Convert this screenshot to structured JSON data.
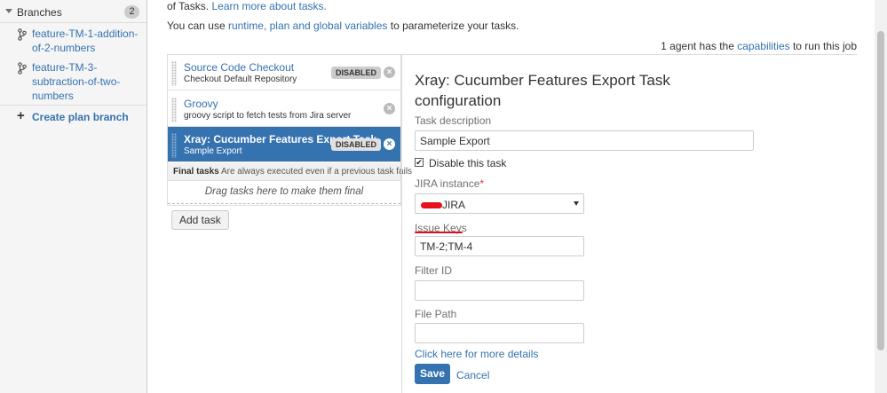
{
  "sidebar": {
    "branches_title": "Branches",
    "branches_count": "2",
    "branches": [
      {
        "label": "feature-TM-1-addition-of-2-numbers",
        "lines": [
          "feature-TM-1-addition-",
          "of-2-numbers"
        ]
      },
      {
        "label": "feature-TM-3-subtraction-of-two-numbers",
        "lines": [
          "feature-TM-3-",
          "subtraction-of-two-",
          "numbers"
        ]
      }
    ],
    "create_branch_label": "Create plan branch"
  },
  "header": {
    "line1_prefix": "of Tasks. ",
    "line1_link": "Learn more about tasks.",
    "line2_prefix": "You can use ",
    "line2_link": "runtime, plan and global variables",
    "line2_suffix": " to parameterize your tasks.",
    "agents_prefix": "1 agent has the ",
    "agents_link": "capabilities",
    "agents_suffix": " to run this job"
  },
  "tasks": [
    {
      "name": "Source Code Checkout",
      "desc": "Checkout Default Repository",
      "badge": "DISABLED",
      "active": false
    },
    {
      "name": "Groovy",
      "desc": "groovy script to fetch tests from Jira server",
      "badge": "",
      "active": false
    },
    {
      "name": "Xray: Cucumber Features Export Task",
      "desc": "Sample Export",
      "badge": "DISABLED",
      "active": true
    }
  ],
  "final_tasks": {
    "title": "Final tasks",
    "note": "Are always executed even if a previous task fails",
    "drop_hint": "Drag tasks here to make them final"
  },
  "add_task_label": "Add task",
  "config": {
    "title": "Xray: Cucumber Features Export Task configuration",
    "task_description_label": "Task description",
    "task_description_value": "Sample Export",
    "disable_label": "Disable this task",
    "disable_checked": "✔",
    "jira_label": "JIRA instance",
    "jira_required": "*",
    "jira_value": "JIRA",
    "issue_keys_label": "Issue Keys",
    "issue_keys_value": "TM-2;TM-4",
    "filter_id_label": "Filter ID",
    "filter_id_value": "",
    "file_path_label": "File Path",
    "file_path_value": "",
    "more_link": "Click here for more details",
    "save_label": "Save",
    "cancel_label": "Cancel"
  },
  "colors": {
    "link": "#3572b0",
    "active_task_bg": "#3572b0",
    "required": "#d04437",
    "annotation_red": "#d9101a"
  },
  "icons": {
    "branch": "branch-icon",
    "remove": "close-circle-icon",
    "grip": "drag-handle-icon",
    "plus": "plus-icon",
    "caret": "caret-down-icon"
  }
}
